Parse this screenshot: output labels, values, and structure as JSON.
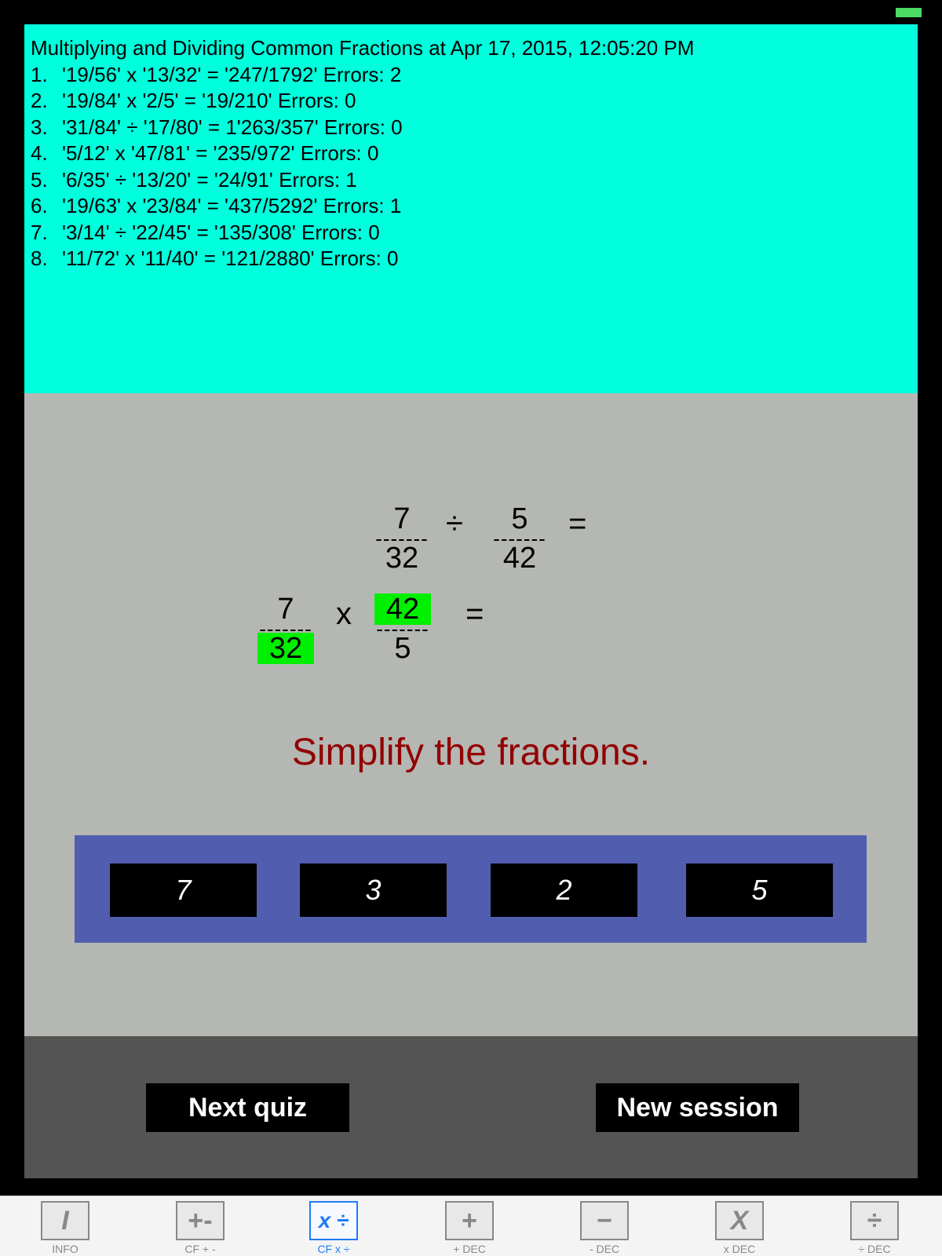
{
  "log": {
    "title": "Multiplying and Dividing Common Fractions at Apr 17, 2015, 12:05:20 PM",
    "lines": [
      {
        "num": "1.",
        "text": "'19/56' x '13/32' = '247/1792' Errors: 2"
      },
      {
        "num": "2.",
        "text": "'19/84' x '2/5' = '19/210' Errors: 0"
      },
      {
        "num": "3.",
        "text": "'31/84' ÷ '17/80' = 1'263/357' Errors: 0"
      },
      {
        "num": "4.",
        "text": "'5/12' x '47/81' = '235/972' Errors: 0"
      },
      {
        "num": "5.",
        "text": "'6/35' ÷ '13/20' = '24/91' Errors: 1"
      },
      {
        "num": "6.",
        "text": "'19/63' x '23/84' = '437/5292' Errors: 1"
      },
      {
        "num": "7.",
        "text": "'3/14' ÷ '22/45' = '135/308' Errors: 0"
      },
      {
        "num": "8.",
        "text": "'11/72' x '11/40' = '121/2880' Errors: 0"
      }
    ]
  },
  "problem": {
    "row1": {
      "left": {
        "num": "7",
        "den": "32"
      },
      "op": "÷",
      "right": {
        "num": "5",
        "den": "42"
      },
      "eq": "="
    },
    "row2": {
      "left": {
        "num": "7",
        "den": "32"
      },
      "op": "x",
      "right": {
        "num": "42",
        "den": "5"
      },
      "eq": "="
    },
    "bar": "-------",
    "hint": "Simplify the fractions."
  },
  "choices": [
    "7",
    "3",
    "2",
    "5"
  ],
  "actions": {
    "next_quiz": "Next quiz",
    "new_session": "New session"
  },
  "tabs": [
    {
      "icon": "I",
      "label": "INFO"
    },
    {
      "icon": "+-",
      "label": "CF + -"
    },
    {
      "icon": "x ÷",
      "label": "CF x ÷"
    },
    {
      "icon": "+",
      "label": "+ DEC"
    },
    {
      "icon": "−",
      "label": "- DEC"
    },
    {
      "icon": "X",
      "label": "x DEC"
    },
    {
      "icon": "÷",
      "label": "÷ DEC"
    }
  ],
  "colors": {
    "log_bg": "#00ffdc",
    "quiz_bg": "#b5b7b3",
    "highlight": "#00f000",
    "hint_text": "#920000",
    "choice_box": "#515eaf",
    "active_tab": "#1e7cf6"
  }
}
